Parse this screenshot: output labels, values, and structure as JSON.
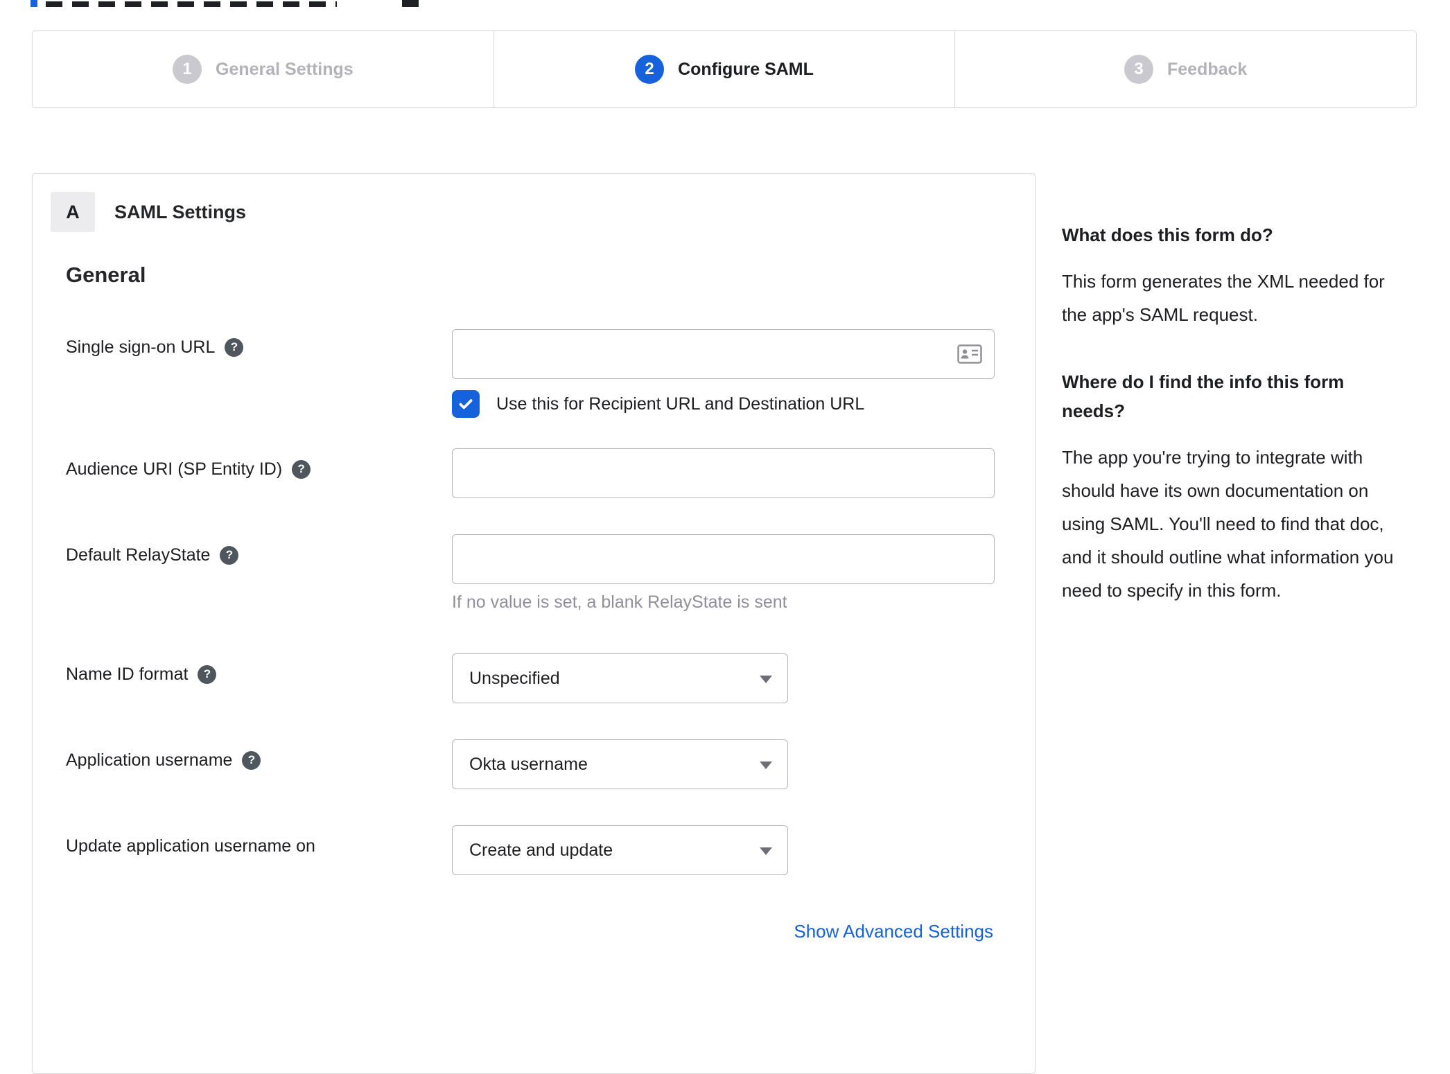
{
  "stepper": {
    "steps": [
      {
        "number": "1",
        "label": "General Settings",
        "state": "inactive"
      },
      {
        "number": "2",
        "label": "Configure SAML",
        "state": "active"
      },
      {
        "number": "3",
        "label": "Feedback",
        "state": "inactive"
      }
    ]
  },
  "panel": {
    "badge": "A",
    "title": "SAML Settings",
    "section": "General",
    "fields": {
      "sso": {
        "label": "Single sign-on URL",
        "value": "",
        "checkbox_label": "Use this for Recipient URL and Destination URL",
        "checkbox_checked": true
      },
      "audience": {
        "label": "Audience URI (SP Entity ID)",
        "value": ""
      },
      "relay": {
        "label": "Default RelayState",
        "value": "",
        "hint": "If no value is set, a blank RelayState is sent"
      },
      "nameid": {
        "label": "Name ID format",
        "value": "Unspecified"
      },
      "appuser": {
        "label": "Application username",
        "value": "Okta username"
      },
      "update": {
        "label": "Update application username on",
        "value": "Create and update"
      }
    },
    "advanced_link": "Show Advanced Settings"
  },
  "sidebar": {
    "q1": "What does this form do?",
    "a1": "This form generates the XML needed for the app's SAML request.",
    "q2": "Where do I find the info this form needs?",
    "a2": "The app you're trying to integrate with should have its own documentation on using SAML. You'll need to find that doc, and it should outline what information you need to specify in this form."
  },
  "colors": {
    "accent": "#1662dd",
    "inactive_step": "#c9c9cf",
    "border": "#d8d8dc"
  }
}
